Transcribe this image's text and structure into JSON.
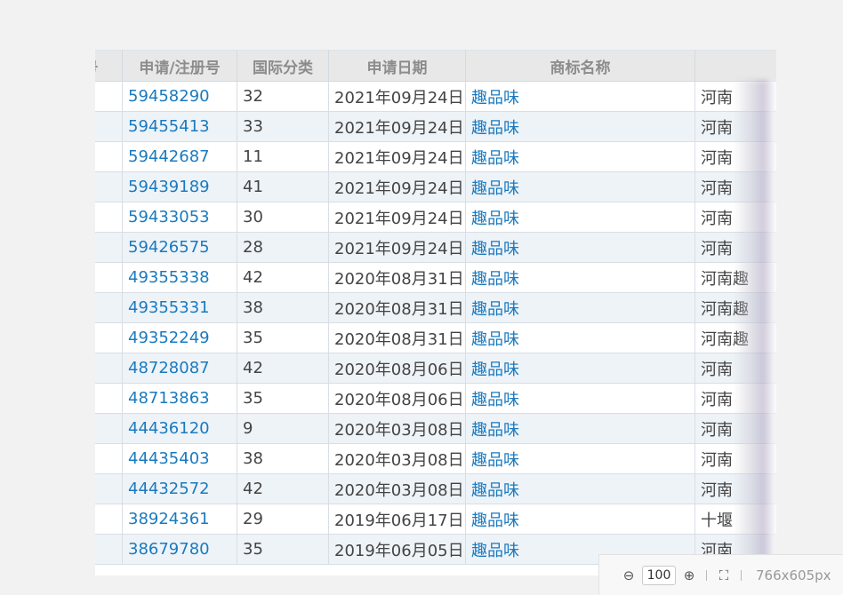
{
  "table": {
    "headers": [
      "号",
      "申请/注册号",
      "国际分类",
      "申请日期",
      "商标名称",
      ""
    ],
    "rows": [
      {
        "reg": "59458290",
        "cls": "32",
        "date": "2021年09月24日",
        "name": "趣品味",
        "applicant": "河南"
      },
      {
        "reg": "59455413",
        "cls": "33",
        "date": "2021年09月24日",
        "name": "趣品味",
        "applicant": "河南"
      },
      {
        "reg": "59442687",
        "cls": "11",
        "date": "2021年09月24日",
        "name": "趣品味",
        "applicant": "河南"
      },
      {
        "reg": "59439189",
        "cls": "41",
        "date": "2021年09月24日",
        "name": "趣品味",
        "applicant": "河南"
      },
      {
        "reg": "59433053",
        "cls": "30",
        "date": "2021年09月24日",
        "name": "趣品味",
        "applicant": "河南"
      },
      {
        "reg": "59426575",
        "cls": "28",
        "date": "2021年09月24日",
        "name": "趣品味",
        "applicant": "河南"
      },
      {
        "reg": "49355338",
        "cls": "42",
        "date": "2020年08月31日",
        "name": "趣品味",
        "applicant": "河南趣"
      },
      {
        "reg": "49355331",
        "cls": "38",
        "date": "2020年08月31日",
        "name": "趣品味",
        "applicant": "河南趣"
      },
      {
        "reg": "49352249",
        "cls": "35",
        "date": "2020年08月31日",
        "name": "趣品味",
        "applicant": "河南趣"
      },
      {
        "reg": "48728087",
        "cls": "42",
        "date": "2020年08月06日",
        "name": "趣品味",
        "applicant": "河南"
      },
      {
        "reg": "48713863",
        "cls": "35",
        "date": "2020年08月06日",
        "name": "趣品味",
        "applicant": "河南"
      },
      {
        "reg": "44436120",
        "cls": "9",
        "date": "2020年03月08日",
        "name": "趣品味",
        "applicant": "河南"
      },
      {
        "reg": "44435403",
        "cls": "38",
        "date": "2020年03月08日",
        "name": "趣品味",
        "applicant": "河南"
      },
      {
        "reg": "44432572",
        "cls": "42",
        "date": "2020年03月08日",
        "name": "趣品味",
        "applicant": "河南"
      },
      {
        "reg": "38924361",
        "cls": "29",
        "date": "2019年06月17日",
        "name": "趣品味",
        "applicant": "十堰"
      },
      {
        "reg": "38679780",
        "cls": "35",
        "date": "2019年06月05日",
        "name": "趣品味",
        "applicant": "河南"
      }
    ]
  },
  "statusbar": {
    "zoom_value": "100",
    "dimensions": "766x605px",
    "zoom_out_icon": "⊖",
    "zoom_in_icon": "⊕",
    "fit_icon": "⛶"
  }
}
